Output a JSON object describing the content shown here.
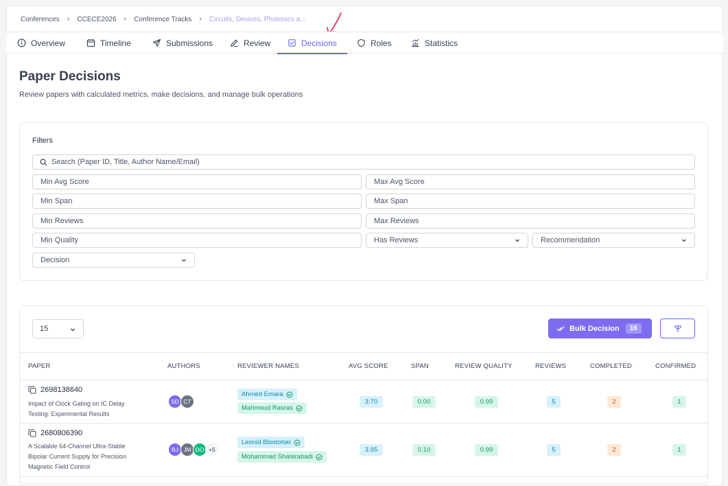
{
  "breadcrumb": [
    "Conferences",
    "CCECE2026",
    "Conference Tracks",
    "Circuits, Devices, Photonics a..."
  ],
  "tabs": [
    {
      "label": "Overview",
      "icon": "info-circle-icon"
    },
    {
      "label": "Timeline",
      "icon": "calendar-icon"
    },
    {
      "label": "Submissions",
      "icon": "send-icon"
    },
    {
      "label": "Review",
      "icon": "pen-icon"
    },
    {
      "label": "Decisions",
      "icon": "check-square-icon",
      "active": true
    },
    {
      "label": "Roles",
      "icon": "shield-icon"
    },
    {
      "label": "Statistics",
      "icon": "bar-chart-icon"
    }
  ],
  "page": {
    "title": "Paper Decisions",
    "subtitle": "Review papers with calculated metrics, make decisions, and manage bulk operations"
  },
  "filters": {
    "label": "Filters",
    "search_placeholder": "Search (Paper ID, Title, Author Name/Email)",
    "min_avg_score": "Min Avg Score",
    "max_avg_score": "Max Avg Score",
    "min_span": "Min Span",
    "max_span": "Max Span",
    "min_reviews": "Min Reviews",
    "max_reviews": "Max Reviews",
    "min_quality": "Min Quality",
    "has_reviews": "Has Reviews",
    "recommendation": "Recommendation",
    "decision": "Decision"
  },
  "toolbar": {
    "page_size": "15",
    "bulk_label": "Bulk Decision",
    "bulk_count": "16"
  },
  "table": {
    "headers": [
      "PAPER",
      "AUTHORS",
      "REVIEWER NAMES",
      "AVG SCORE",
      "SPAN",
      "REVIEW QUALITY",
      "REVIEWS",
      "COMPLETED",
      "CONFIRMED"
    ],
    "rows": [
      {
        "id": "2698138640",
        "title_lines": [
          "Impact of Clock Gating on IC Delay",
          "Testing: Experimental Results"
        ],
        "authors": [
          {
            "initials": "SD",
            "color": "#7c6cf0"
          },
          {
            "initials": "CT",
            "color": "#6b7280"
          }
        ],
        "reviewers": [
          "Ahmed Emara",
          "Mahmoud Rasras"
        ],
        "avg_score": "3.70",
        "span": "0.00",
        "quality": "0.99",
        "reviews": "5",
        "completed": "2",
        "confirmed": "1"
      },
      {
        "id": "2680806390",
        "title_lines": [
          "A Scalable 64-Channel Ultra-Stable",
          "Bipolar Current Supply for Precision",
          "Magnetic Field Control"
        ],
        "authors": [
          {
            "initials": "BJ",
            "color": "#7c6cf0"
          },
          {
            "initials": "JM",
            "color": "#6b7280"
          },
          {
            "initials": "DO",
            "color": "#10b981"
          }
        ],
        "more_authors": "+5",
        "reviewers": [
          "Leonid Blostotski",
          "Mohammad Shaterabadi"
        ],
        "avg_score": "3.95",
        "span": "0.10",
        "quality": "0.99",
        "reviews": "5",
        "completed": "2",
        "confirmed": "1"
      }
    ]
  }
}
